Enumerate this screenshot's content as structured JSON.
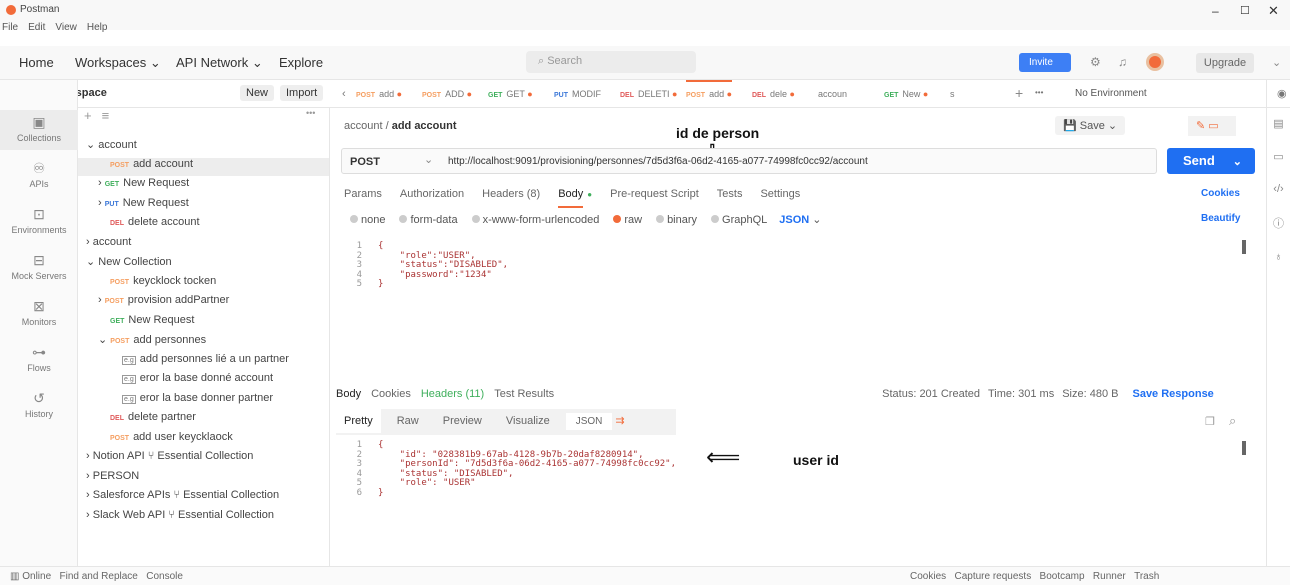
{
  "window": {
    "title": "Postman",
    "menu": [
      "File",
      "Edit",
      "View",
      "Help"
    ]
  },
  "nav": {
    "home": "Home",
    "workspaces": "Workspaces ⌄",
    "api_network": "API Network ⌄",
    "explore": "Explore",
    "search_placeholder": "Search",
    "invite": "Invite",
    "upgrade": "Upgrade"
  },
  "sidebar": {
    "workspace": "My Workspace",
    "new": "New",
    "import": "Import",
    "rail": [
      "Collections",
      "APIs",
      "Environments",
      "Mock Servers",
      "Monitors",
      "Flows",
      "History"
    ],
    "tree": [
      {
        "indent": 0,
        "label": "account",
        "arrow": "⌄"
      },
      {
        "indent": 2,
        "method": "POST",
        "label": "add account",
        "selected": true
      },
      {
        "indent": 1,
        "method": "GET",
        "label": "New Request",
        "arrow": "›"
      },
      {
        "indent": 1,
        "method": "PUT",
        "label": "New Request",
        "arrow": "›"
      },
      {
        "indent": 2,
        "method": "DEL",
        "label": "delete account"
      },
      {
        "indent": 0,
        "label": "account",
        "arrow": "›"
      },
      {
        "indent": 0,
        "label": "New Collection",
        "arrow": "⌄"
      },
      {
        "indent": 2,
        "method": "POST",
        "label": "keycklock tocken"
      },
      {
        "indent": 1,
        "method": "POST",
        "label": "provision addPartner",
        "arrow": "›"
      },
      {
        "indent": 2,
        "method": "GET",
        "label": "New Request"
      },
      {
        "indent": 1,
        "method": "POST",
        "label": "add personnes",
        "arrow": "⌄"
      },
      {
        "indent": 3,
        "eg": "e.g",
        "label": "add personnes lié a un partner"
      },
      {
        "indent": 3,
        "eg": "e.g",
        "label": "eror la base donné account"
      },
      {
        "indent": 3,
        "eg": "e.g",
        "label": "eror la base donner partner"
      },
      {
        "indent": 2,
        "method": "DEL",
        "label": "delete partner"
      },
      {
        "indent": 2,
        "method": "POST",
        "label": "add user keycklaock"
      },
      {
        "indent": 0,
        "label": "Notion API ⑂ Essential Collection",
        "arrow": "›"
      },
      {
        "indent": 0,
        "label": "PERSON",
        "arrow": "›"
      },
      {
        "indent": 0,
        "label": "Salesforce APIs ⑂ Essential Collection",
        "arrow": "›"
      },
      {
        "indent": 0,
        "label": "Slack Web API ⑂ Essential Collection",
        "arrow": "›"
      }
    ]
  },
  "tabs": [
    {
      "m": "POST",
      "l": "add"
    },
    {
      "m": "POST",
      "l": "ADD"
    },
    {
      "m": "GET",
      "l": "GET"
    },
    {
      "m": "PUT",
      "l": "MODIF"
    },
    {
      "m": "DEL",
      "l": "DELETI"
    },
    {
      "m": "POST",
      "l": "add"
    },
    {
      "m": "DEL",
      "l": "dele"
    },
    {
      "m": "",
      "l": "accoun"
    },
    {
      "m": "GET",
      "l": "New"
    },
    {
      "m": "",
      "l": "s"
    }
  ],
  "env": "No Environment",
  "request": {
    "crumb_parent": "account",
    "crumb_name": "add account",
    "method": "POST",
    "url": "http://localhost:9091/provisioning/personnes/7d5d3f6a-06d2-4165-a077-74998fc0cc92/account",
    "send": "Send",
    "save": "Save",
    "tabs": [
      "Params",
      "Authorization",
      "Headers (8)",
      "Body",
      "Pre-request Script",
      "Tests",
      "Settings"
    ],
    "cookies": "Cookies",
    "body_opts": [
      "none",
      "form-data",
      "x-www-form-urlencoded",
      "raw",
      "binary",
      "GraphQL"
    ],
    "lang": "JSON",
    "beautify": "Beautify",
    "body": [
      "{",
      "    \"role\":\"USER\",",
      "    \"status\":\"DISABLED\",",
      "    \"password\":\"1234\"",
      "}"
    ]
  },
  "annotations": {
    "person": "id de person",
    "user": "user id"
  },
  "response": {
    "tabs": [
      "Body",
      "Cookies",
      "Headers (11)",
      "Test Results"
    ],
    "status": "Status: 201 Created",
    "time": "Time: 301 ms",
    "size": "Size: 480 B",
    "save": "Save Response",
    "views": [
      "Pretty",
      "Raw",
      "Preview",
      "Visualize"
    ],
    "lang": "JSON",
    "body": [
      "{",
      "    \"id\": \"028381b9-67ab-4128-9b7b-20daf8280914\",",
      "    \"personId\": \"7d5d3f6a-06d2-4165-a077-74998fc0cc92\",",
      "    \"status\": \"DISABLED\",",
      "    \"role\": \"USER\"",
      "}"
    ]
  },
  "statusbar": {
    "left": [
      "Online",
      "Find and Replace",
      "Console"
    ],
    "right": [
      "Cookies",
      "Capture requests",
      "Bootcamp",
      "Runner",
      "Trash"
    ]
  },
  "colors": {
    "post": "#f59e60",
    "get": "#3faf5c",
    "put": "#3c78d8",
    "del": "#e05a5a",
    "send": "#1f6ff2",
    "accent": "#f26b3a"
  }
}
